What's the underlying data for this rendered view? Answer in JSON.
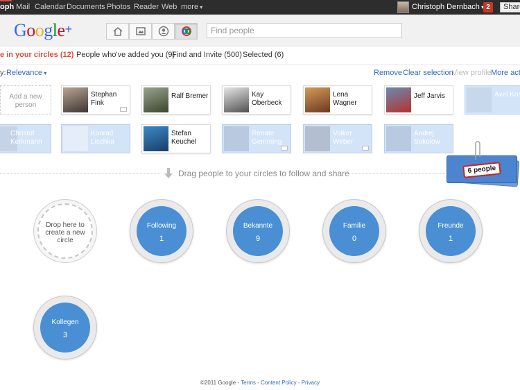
{
  "topbar": {
    "active_item": "oph",
    "items": [
      "Mail",
      "Calendar",
      "Documents",
      "Photos",
      "Reader",
      "Web",
      "more"
    ],
    "user_name": "Christoph Dernbach",
    "notifications": "2",
    "share_label": "Share"
  },
  "header": {
    "logo": {
      "g": "G",
      "o1": "o",
      "o2": "o",
      "g2": "g",
      "l": "l",
      "e": "e",
      "plus": "+"
    },
    "search_placeholder": "Find people",
    "nav_icons": [
      "home-icon",
      "photos-icon",
      "profile-icon",
      "circles-icon"
    ]
  },
  "tabs": [
    {
      "label": "e in your circles (12)",
      "active": true
    },
    {
      "label": "People who've added you (9)",
      "active": false
    },
    {
      "label": "Find and Invite (500)",
      "active": false
    },
    {
      "label": "Selected (6)",
      "active": false
    }
  ],
  "sort": {
    "label": "y:",
    "value": "Relevance"
  },
  "actions": [
    {
      "label": "Remove",
      "enabled": true
    },
    {
      "label": "Clear selection",
      "enabled": true
    },
    {
      "label": "View profile",
      "enabled": false
    },
    {
      "label": "More actio",
      "enabled": true
    }
  ],
  "add_person": "Add a new person",
  "people": [
    {
      "name": "Stephan Fink",
      "selected": false,
      "mail": true
    },
    {
      "name": "Ralf Bremer",
      "selected": false,
      "mail": false
    },
    {
      "name": "Kay Oberbeck",
      "selected": false,
      "mail": false
    },
    {
      "name": "Lena Wagner",
      "selected": false,
      "mail": false
    },
    {
      "name": "Jeff Jarvis",
      "selected": false,
      "mail": false
    },
    {
      "name": "Axel Kossel",
      "selected": true,
      "mail": false
    },
    {
      "name": "Christof Kerkmann",
      "selected": true,
      "mail": false
    },
    {
      "name": "Konrad Lischka",
      "selected": true,
      "mail": false
    },
    {
      "name": "Stefan Keuchel",
      "selected": false,
      "mail": false
    },
    {
      "name": "Renate Gemming",
      "selected": true,
      "mail": true
    },
    {
      "name": "Volker Weber",
      "selected": true,
      "mail": true
    },
    {
      "name": "Andrej Sokolow",
      "selected": true,
      "mail": false
    }
  ],
  "drag_hint": "Drag people to your circles to follow and share",
  "selection_tag": "6 people",
  "new_circle": "Drop here to create a new circle",
  "circles": [
    {
      "name": "Following",
      "count": "1"
    },
    {
      "name": "Bekannte",
      "count": "9"
    },
    {
      "name": "Familie",
      "count": "0"
    },
    {
      "name": "Freunde",
      "count": "1"
    },
    {
      "name": "Kollegen",
      "count": "3"
    }
  ],
  "footer": {
    "copyright": "©2011 Google",
    "sep": " - ",
    "terms": "Terms",
    "content_policy": "Content Policy",
    "privacy": "Privacy"
  },
  "colors": {
    "accent_red": "#dd4b39",
    "link_blue": "#3366cc",
    "circle_blue": "#4a8fd4",
    "selected_card": "#d3e3f8"
  }
}
